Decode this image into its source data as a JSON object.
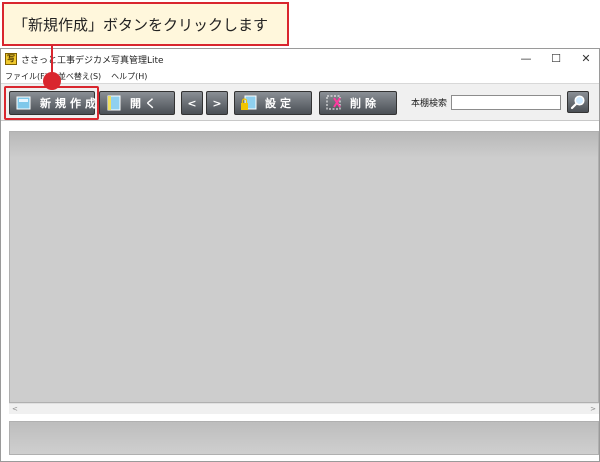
{
  "callout": {
    "text": "「新規作成」ボタンをクリックします"
  },
  "window": {
    "title": "ささっと工事デジカメ写真管理Lite",
    "controls": {
      "minimize": "—",
      "maximize": "☐",
      "close": "✕"
    }
  },
  "menu": [
    {
      "label": "ファイル(F)"
    },
    {
      "label": "並べ替え(S)"
    },
    {
      "label": "ヘルプ(H)"
    }
  ],
  "toolbar": {
    "new_label": "新規作成",
    "open_label": "開く",
    "prev_label": "<",
    "next_label": ">",
    "settings_label": "設定",
    "delete_label": "削除",
    "search_label": "本棚検索",
    "search_value": ""
  },
  "scrollbar": {
    "left_arrow": "<",
    "right_arrow": ">"
  },
  "colors": {
    "accent": "#d9262e",
    "callout_bg": "#fff7dc",
    "button_dark": "#4a4f55"
  }
}
